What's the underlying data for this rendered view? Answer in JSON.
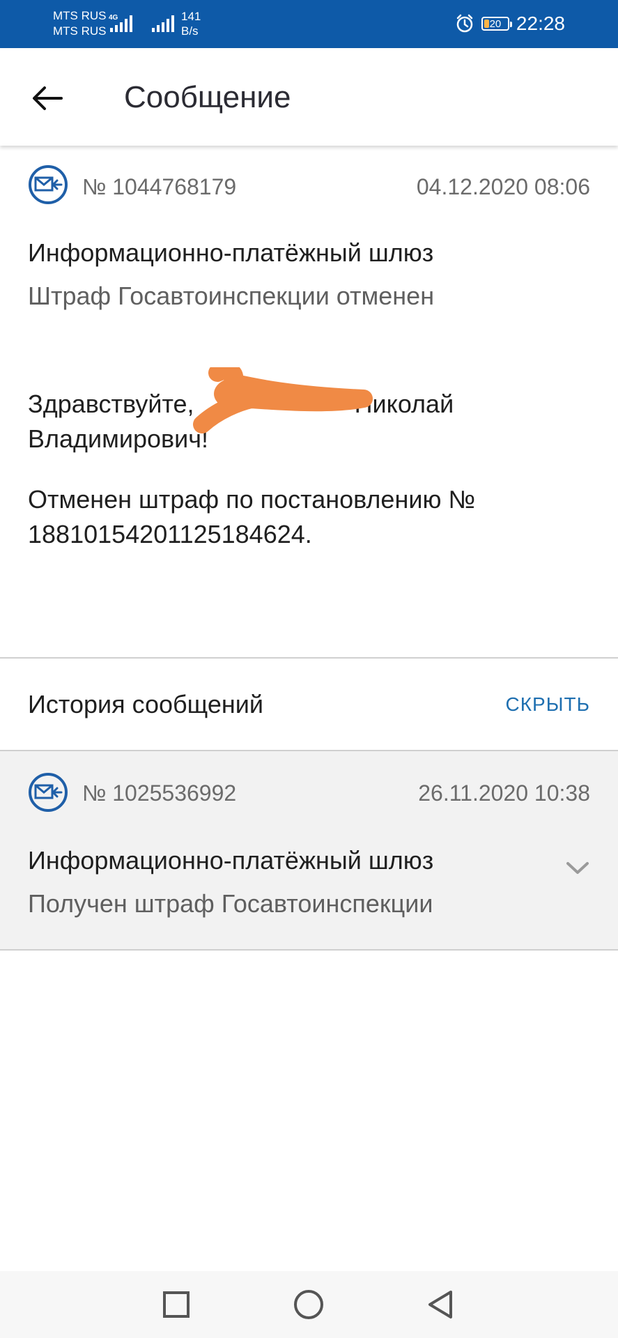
{
  "status_bar": {
    "carrier_1": "MTS RUS",
    "carrier_2": "MTS RUS",
    "network_type": "4G",
    "speed_value": "141",
    "speed_unit": "B/s",
    "battery_level": "20",
    "time": "22:28",
    "background_color": "#0e5aa8"
  },
  "app_bar": {
    "title": "Сообщение",
    "back_icon": "arrow-left-icon"
  },
  "message": {
    "number": "№ 1044768179",
    "date": "04.12.2020 08:06",
    "icon": "incoming-mail-icon",
    "sender": "Информационно-платёжный шлюз",
    "subject": "Штраф Госавтоинспекции отменен",
    "greeting_start": "Здравствуйте, ",
    "greeting_name": "Николай",
    "greeting_patronymic": "Владимирович!",
    "body": "Отменен штраф по постановлению № 18810154201125184624.",
    "redaction_color": "#f08a45"
  },
  "history": {
    "title": "История сообщений",
    "hide_label": "СКРЫТЬ",
    "items": [
      {
        "number": "№ 1025536992",
        "date": "26.11.2020 10:38",
        "sender": "Информационно-платёжный шлюз",
        "subject": "Получен штраф Госавтоинспекции",
        "icon": "incoming-mail-icon"
      }
    ]
  },
  "nav_bar": {
    "recent_icon": "square-icon",
    "home_icon": "circle-icon",
    "back_icon": "triangle-back-icon"
  },
  "colors": {
    "accent": "#1e6fb0",
    "icon_blue": "#1f5fa8"
  }
}
